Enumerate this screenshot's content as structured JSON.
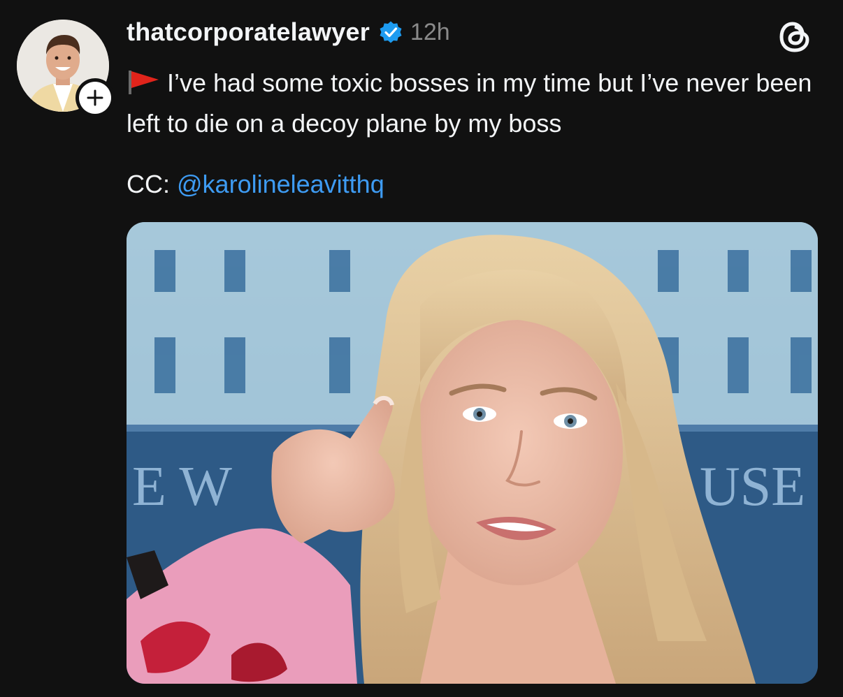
{
  "post": {
    "username": "thatcorporatelawyer",
    "timestamp": "12h",
    "text": "I’ve had some toxic bosses in my time but I’ve never been left to die on a decoy plane by my boss",
    "cc_label": "CC:",
    "mention": "@karolineleavitthq",
    "media_alt": "Woman with blonde hair pointing at the camera in front of a White House backdrop",
    "backdrop_letters_left": "E W",
    "backdrop_letters_right": "USE"
  },
  "colors": {
    "background": "#111111",
    "text": "#f3f5f7",
    "secondary_text": "#8a8a8a",
    "link": "#3e9bf2",
    "verified": "#1d9bf0"
  },
  "icons": {
    "verified": "verified-badge-icon",
    "flag": "red-flag-icon",
    "threads": "threads-logo-icon",
    "follow": "plus-icon"
  }
}
